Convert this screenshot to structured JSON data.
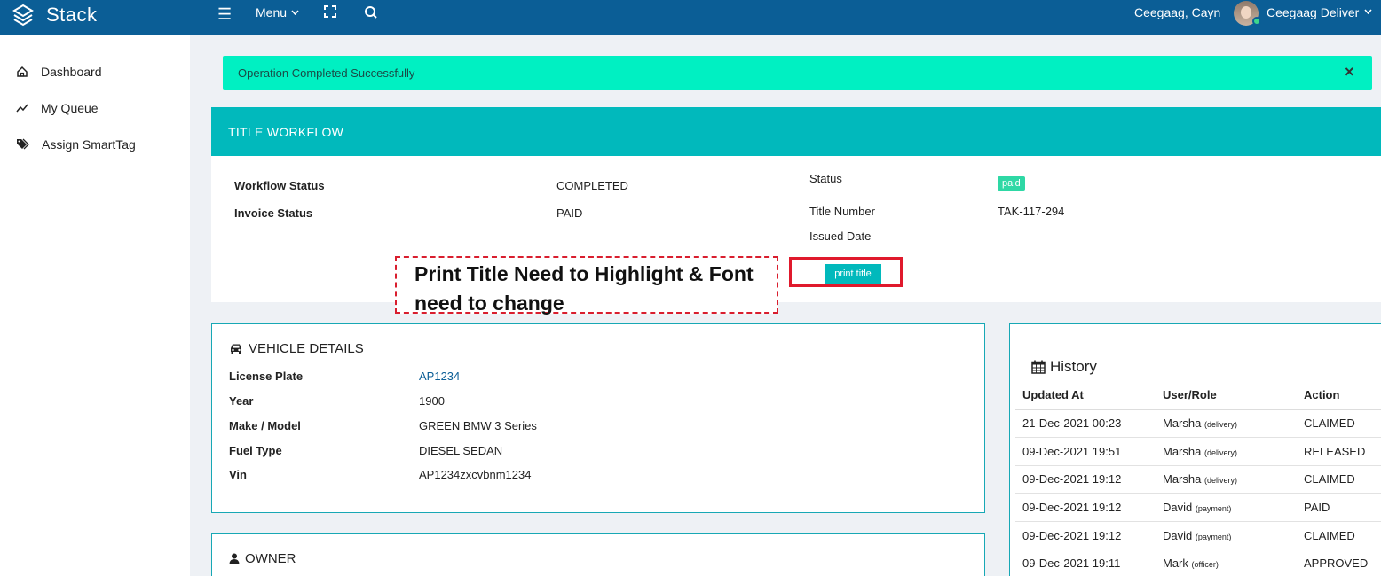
{
  "topbar": {
    "brand": "Stack",
    "menu_label": "Menu",
    "user_name": "Ceegaag, Cayn",
    "role_name": "Ceegaag Deliver"
  },
  "sidebar": {
    "items": [
      {
        "label": "Dashboard",
        "icon": "home-icon"
      },
      {
        "label": "My Queue",
        "icon": "trend-line-icon"
      },
      {
        "label": "Assign SmartTag",
        "icon": "tags-icon"
      }
    ]
  },
  "alert": {
    "message": "Operation Completed Successfully",
    "close_glyph": "×"
  },
  "workflow": {
    "title": "TITLE WORKFLOW",
    "workflow_status_label": "Workflow Status",
    "workflow_status_value": "COMPLETED",
    "invoice_status_label": "Invoice Status",
    "invoice_status_value": "PAID",
    "status_label": "Status",
    "status_badge": "paid",
    "title_number_label": "Title Number",
    "title_number_value": "TAK-117-294",
    "issued_date_label": "Issued Date",
    "print_button": "print title"
  },
  "annotation": {
    "text": "Print Title Need to Highlight & Font need to change"
  },
  "vehicle": {
    "title": "VEHICLE DETAILS",
    "rows": [
      {
        "label": "License Plate",
        "value": "AP1234"
      },
      {
        "label": "Year",
        "value": "1900"
      },
      {
        "label": "Make / Model",
        "value": "GREEN BMW 3 Series"
      },
      {
        "label": "Fuel Type",
        "value": "DIESEL SEDAN"
      },
      {
        "label": "Vin",
        "value": "AP1234zxcvbnm1234"
      }
    ]
  },
  "owner": {
    "title": "OWNER"
  },
  "history": {
    "title": "History",
    "columns": [
      "Updated At",
      "User/Role",
      "Action"
    ],
    "rows": [
      {
        "updated": "21-Dec-2021 00:23",
        "user": "Marsha",
        "role": "(delivery)",
        "action": "CLAIMED"
      },
      {
        "updated": "09-Dec-2021 19:51",
        "user": "Marsha",
        "role": "(delivery)",
        "action": "RELEASED"
      },
      {
        "updated": "09-Dec-2021 19:12",
        "user": "Marsha",
        "role": "(delivery)",
        "action": "CLAIMED"
      },
      {
        "updated": "09-Dec-2021 19:12",
        "user": "David",
        "role": "(payment)",
        "action": "PAID"
      },
      {
        "updated": "09-Dec-2021 19:12",
        "user": "David",
        "role": "(payment)",
        "action": "CLAIMED"
      },
      {
        "updated": "09-Dec-2021 19:11",
        "user": "Mark",
        "role": "(officer)",
        "action": "APPROVED"
      }
    ]
  },
  "colors": {
    "topbar": "#0b5e96",
    "accent": "#01b9bc",
    "alert": "#00f0c2",
    "annotation_red": "#e0192c"
  }
}
